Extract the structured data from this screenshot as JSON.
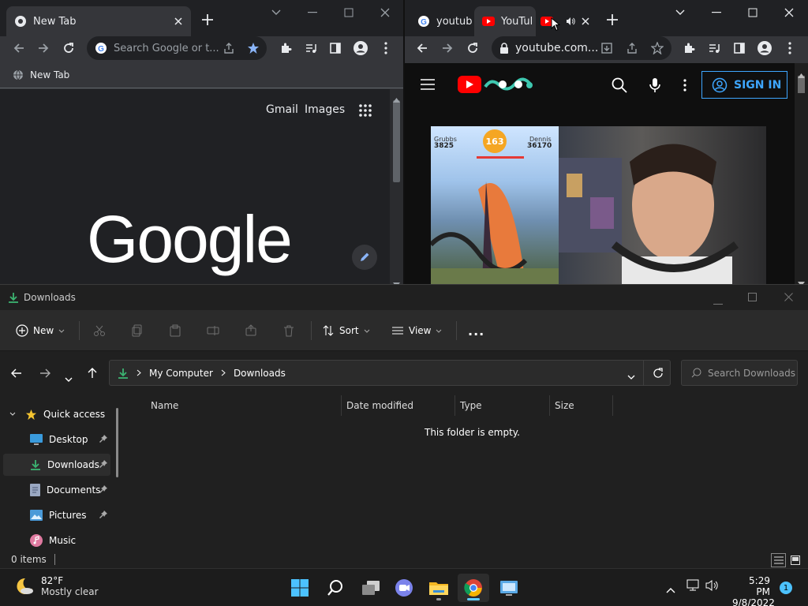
{
  "chrome_left": {
    "tab_title": "New Tab",
    "omnibox_placeholder": "Search Google or t...",
    "bookmark_label": "New Tab",
    "gmail_link": "Gmail",
    "images_link": "Images",
    "google_logo": "Google"
  },
  "chrome_right": {
    "tabs": [
      {
        "label": "youtub"
      },
      {
        "label": "YouTul"
      },
      {
        "label": "Y"
      }
    ],
    "url": "youtube.com...",
    "sign_in_label": "SIGN IN",
    "video": {
      "left_score_label": "Grubbs",
      "left_cp": "3825",
      "right_score_label": "Dennis",
      "right_cp": "36170",
      "timer": "163"
    }
  },
  "explorer": {
    "title": "Downloads",
    "cmd": {
      "new_label": "New",
      "sort_label": "Sort",
      "view_label": "View",
      "more_label": "..."
    },
    "breadcrumb": [
      "My Computer",
      "Downloads"
    ],
    "search_placeholder": "Search Downloads",
    "sidebar": [
      {
        "label": "Quick access"
      },
      {
        "label": "Desktop"
      },
      {
        "label": "Downloads"
      },
      {
        "label": "Documents"
      },
      {
        "label": "Pictures"
      },
      {
        "label": "Music"
      }
    ],
    "columns": [
      "Name",
      "Date modified",
      "Type",
      "Size"
    ],
    "empty_message": "This folder is empty.",
    "status": "0 items"
  },
  "taskbar": {
    "weather_temp": "82°F",
    "weather_desc": "Mostly clear",
    "time": "5:29 PM",
    "date": "9/8/2022",
    "notification_count": "1"
  },
  "colors": {
    "accent": "#8ab4f8",
    "youtube_red": "#ff0000",
    "signin_blue": "#3ea6ff",
    "taskbar_active": "#60cdff"
  }
}
